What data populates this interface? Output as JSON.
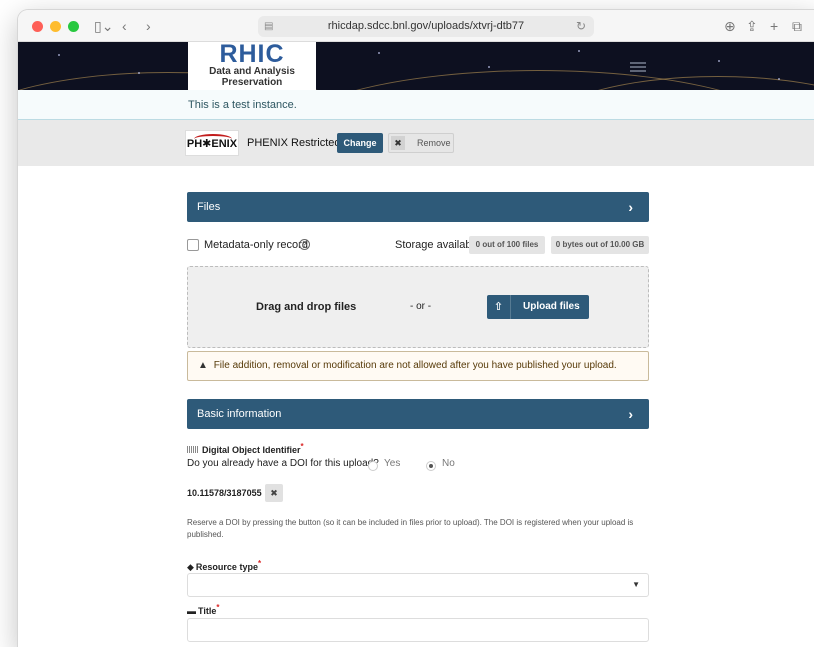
{
  "browser": {
    "url": "rhicdap.sdcc.bnl.gov/uploads/xtvrj-dtb77"
  },
  "header": {
    "logo_main": "RHIC",
    "logo_line1": "Data and Analysis",
    "logo_line2": "Preservation"
  },
  "notice": "This is a test instance.",
  "community": {
    "logo_text": "PH✱ENIX",
    "name": "PHENIX Restricted",
    "change_label": "Change",
    "remove_label": "Remove"
  },
  "files": {
    "section_title": "Files",
    "metadata_only_label": "Metadata-only record",
    "storage_label": "Storage available",
    "files_count": "0 out of 100 files",
    "bytes_count": "0 bytes out of 10.00 GB",
    "drop_text": "Drag and drop files",
    "or_text": "- or -",
    "upload_label": "Upload files",
    "warning": "File addition, removal or modification are not allowed after you have published your upload."
  },
  "basic": {
    "section_title": "Basic information",
    "doi_title": "Digital Object Identifier",
    "doi_question": "Do you already have a DOI for this upload?",
    "yes_label": "Yes",
    "no_label": "No",
    "doi_value": "10.11578/3187055",
    "doi_help": "Reserve a DOI by pressing the button (so it can be included in files prior to upload). The DOI is registered when your upload is published.",
    "resource_type_label": "Resource type",
    "title_label": "Title",
    "required_mark": "*"
  },
  "colors": {
    "primary": "#2e5a79",
    "banner_bg": "#0d1020",
    "required": "#db2828"
  }
}
